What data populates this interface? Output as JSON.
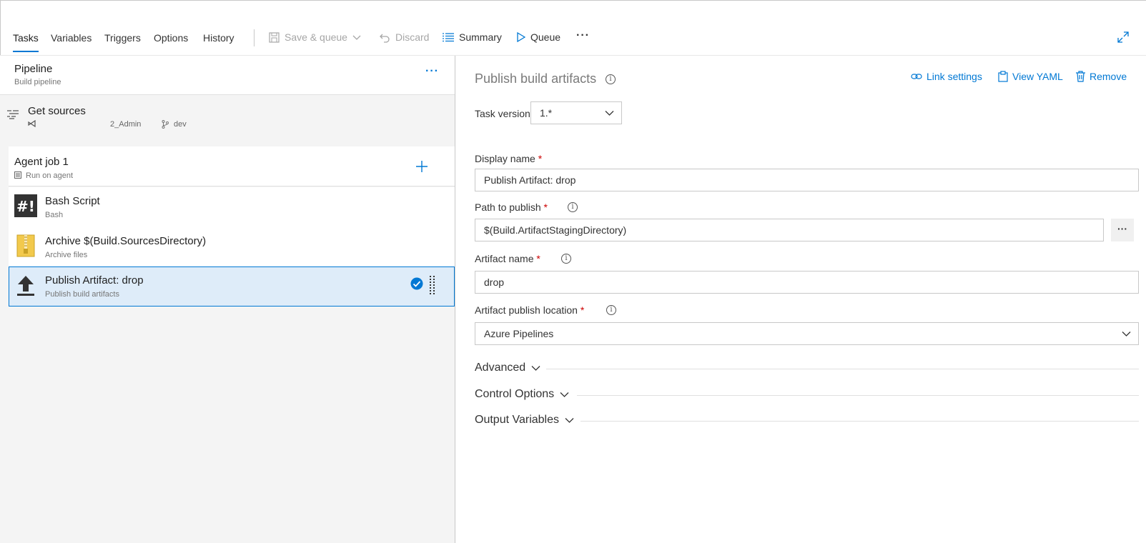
{
  "tabs": [
    {
      "label": "Tasks",
      "active": true
    },
    {
      "label": "Variables"
    },
    {
      "label": "Triggers"
    },
    {
      "label": "Options"
    },
    {
      "label": "History"
    }
  ],
  "toolbar": {
    "save_queue": "Save & queue",
    "discard": "Discard",
    "summary": "Summary",
    "queue": "Queue",
    "more": "···"
  },
  "pipeline": {
    "title": "Pipeline",
    "subtitle": "Build pipeline",
    "more": "···"
  },
  "get_sources": {
    "title": "Get sources",
    "repo": "2_Admin",
    "branch": "dev"
  },
  "agent_job": {
    "title": "Agent job 1",
    "subtitle": "Run on agent"
  },
  "tasks": [
    {
      "name": "Bash Script",
      "sub": "Bash",
      "icon": "bash-icon"
    },
    {
      "name": "Archive $(Build.SourcesDirectory)",
      "sub": "Archive files",
      "icon": "archive-icon"
    },
    {
      "name": "Publish Artifact: drop",
      "sub": "Publish build artifacts",
      "icon": "upload-icon",
      "selected": true
    }
  ],
  "detail": {
    "title": "Publish build artifacts",
    "link_settings": "Link settings",
    "view_yaml": "View YAML",
    "remove": "Remove",
    "task_version_label": "Task version",
    "task_version_value": "1.*",
    "display_name_label": "Display name",
    "display_name_value": "Publish Artifact: drop",
    "path_label": "Path to publish",
    "path_value": "$(Build.ArtifactStagingDirectory)",
    "browse": "···",
    "artifact_name_label": "Artifact name",
    "artifact_name_value": "drop",
    "location_label": "Artifact publish location",
    "location_value": "Azure Pipelines",
    "required_mark": "*",
    "info_glyph": "i"
  },
  "sections": [
    "Advanced",
    "Control Options",
    "Output Variables"
  ],
  "colors": {
    "accent": "#0078d4",
    "selected_bg": "#deecf9",
    "required": "#cc0000"
  }
}
